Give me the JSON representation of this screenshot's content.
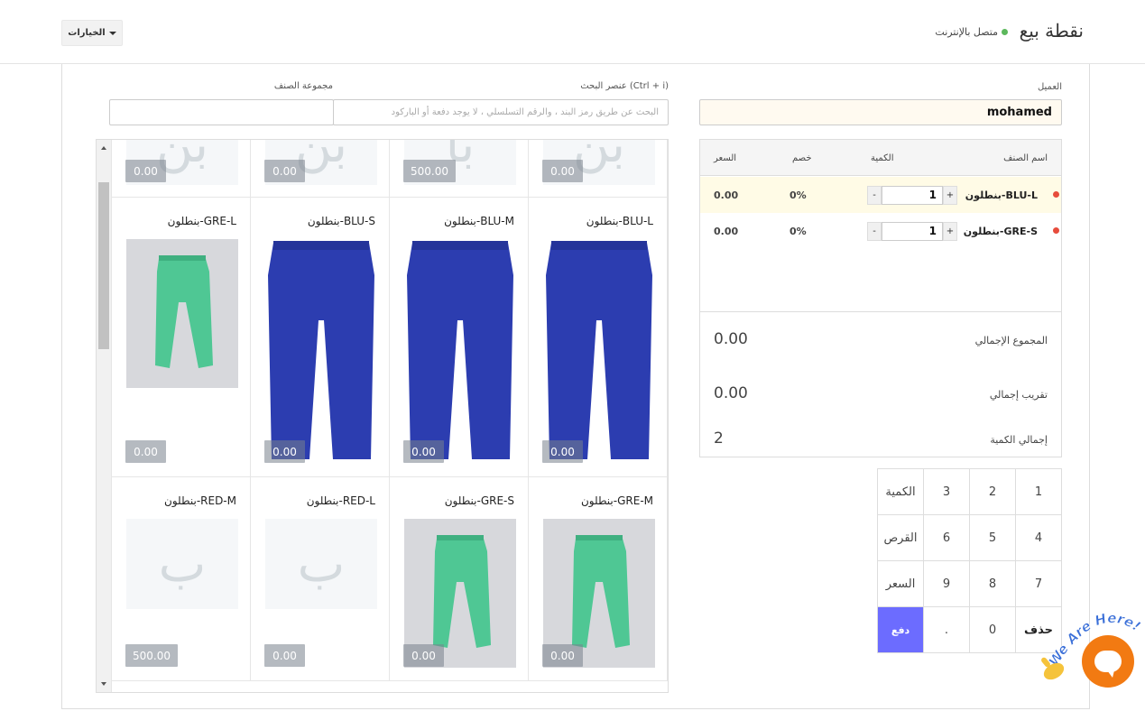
{
  "header": {
    "title": "نقطة بيع",
    "status": "متصل بالإنترنت",
    "options_label": "الخيارات"
  },
  "form": {
    "customer_label": "العميل",
    "customer_value": "mohamed",
    "search_label": "عنصر البحث (Ctrl + i)",
    "search_placeholder": "البحث عن طريق رمز البند ، والرقم التسلسلي ، لا يوجد دفعة أو الباركود",
    "group_label": "مجموعة الصنف",
    "group_value": ""
  },
  "top_partial_row": [
    {
      "price": "0.00",
      "letters": "بن"
    },
    {
      "price": "500.00",
      "letters": "با"
    },
    {
      "price": "0.00",
      "letters": "بن"
    },
    {
      "price": "0.00",
      "letters": "بن"
    }
  ],
  "items": [
    {
      "name": "بنطلون-BLU-L",
      "price": "0.00",
      "image": "blue-pants"
    },
    {
      "name": "بنطلون-BLU-M",
      "price": "0.00",
      "image": "blue-pants"
    },
    {
      "name": "بنطلون-BLU-S",
      "price": "0.00",
      "image": "blue-pants"
    },
    {
      "name": "بنطلون-GRE-L",
      "price": "0.00",
      "image": "green-pants"
    },
    {
      "name": "بنطلون-GRE-M",
      "price": "0.00",
      "image": "green-pants"
    },
    {
      "name": "بنطلون-GRE-S",
      "price": "0.00",
      "image": "green-pants"
    },
    {
      "name": "بنطلون-RED-L",
      "price": "0.00",
      "image": "placeholder",
      "letter": "ب"
    },
    {
      "name": "بنطلون-RED-M",
      "price": "500.00",
      "image": "placeholder",
      "letter": "ب"
    }
  ],
  "cart": {
    "headers": {
      "name": "اسم الصنف",
      "qty": "الكمية",
      "discount": "خصم",
      "price": "السعر"
    },
    "rows": [
      {
        "name": "بنطلون-BLU-L",
        "qty": "1",
        "discount": "0%",
        "price": "0.00",
        "minus": "-",
        "plus": "+"
      },
      {
        "name": "بنطلون-GRE-S",
        "qty": "1",
        "discount": "0%",
        "price": "0.00",
        "minus": "-",
        "plus": "+"
      }
    ],
    "totals": {
      "grand_total_label": "المجموع الإجمالي",
      "grand_total_value": "0.00",
      "rounded_total_label": "تقريب إجمالي",
      "rounded_total_value": "0.00",
      "total_qty_label": "إجمالي الكمية",
      "total_qty_value": "2"
    }
  },
  "keypad": {
    "keys": [
      "1",
      "2",
      "3",
      "الكمية",
      "4",
      "5",
      "6",
      "القرص",
      "7",
      "8",
      "9",
      "السعر",
      "حذف",
      "0",
      ".",
      "دفع"
    ]
  },
  "widget": {
    "badge_text": "We Are Here!"
  },
  "colors": {
    "pay_button": "#6c6cff",
    "online_dot": "#5cb85c",
    "row_dot": "#e74c3c",
    "chat_bubble": "#f27a12",
    "blue_pants": "#2c3db0",
    "green_pants": "#4fc794"
  }
}
